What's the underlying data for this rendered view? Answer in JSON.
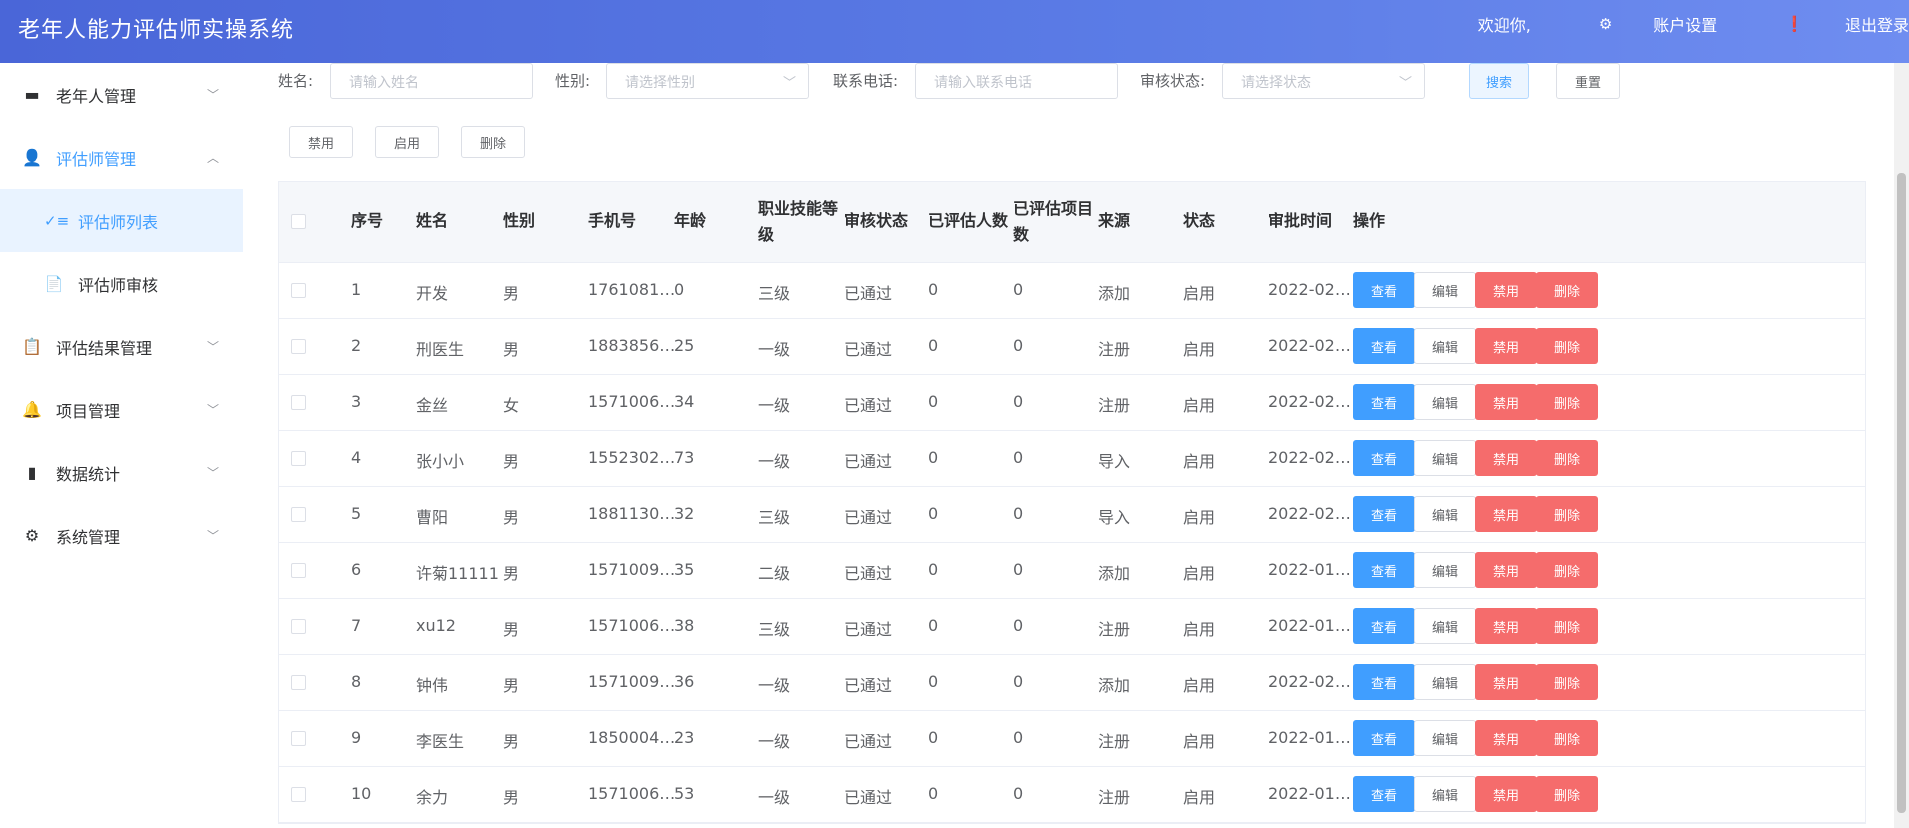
{
  "header": {
    "app_title": "老年人能力评估师实操系统",
    "welcome": "欢迎你,",
    "account_settings": "账户设置",
    "logout": "退出登录"
  },
  "sidebar": {
    "items": [
      {
        "label": "老年人管理",
        "icon": "monitor-icon"
      },
      {
        "label": "评估师管理",
        "icon": "user-icon"
      },
      {
        "label": "评估结果管理",
        "icon": "clipboard-icon"
      },
      {
        "label": "项目管理",
        "icon": "bell-icon"
      },
      {
        "label": "数据统计",
        "icon": "bar-chart-icon"
      },
      {
        "label": "系统管理",
        "icon": "gear-icon"
      }
    ],
    "subitems": [
      {
        "label": "评估师列表",
        "icon": "list-check-icon"
      },
      {
        "label": "评估师审核",
        "icon": "document-icon"
      }
    ]
  },
  "filters": {
    "name_label": "姓名:",
    "name_placeholder": "请输入姓名",
    "gender_label": "性别:",
    "gender_placeholder": "请选择性别",
    "phone_label": "联系电话:",
    "phone_placeholder": "请输入联系电话",
    "status_label": "审核状态:",
    "status_placeholder": "请选择状态",
    "search_button": "搜索",
    "reset_button": "重置"
  },
  "bulk_actions": {
    "disable": "禁用",
    "enable": "启用",
    "delete": "删除"
  },
  "table": {
    "headers": {
      "index": "序号",
      "name": "姓名",
      "gender": "性别",
      "phone": "手机号",
      "age": "年龄",
      "level_line1": "职业技能等",
      "level_line2": "级",
      "audit_status": "审核状态",
      "assessed_people": "已评估人数",
      "assessed_items_line1": "已评估项目",
      "assessed_items_line2": "数",
      "source": "来源",
      "status": "状态",
      "approval_time": "审批时间",
      "actions": "操作"
    },
    "row_actions": {
      "view": "查看",
      "edit": "编辑",
      "disable": "禁用",
      "delete": "删除"
    },
    "rows": [
      {
        "index": "1",
        "name": "开发",
        "gender": "男",
        "phone": "1761081…",
        "age": "0",
        "level": "三级",
        "audit_status": "已通过",
        "assessed_people": "0",
        "assessed_items": "0",
        "source": "添加",
        "status": "启用",
        "approval_time": "2022-02…"
      },
      {
        "index": "2",
        "name": "刑医生",
        "gender": "男",
        "phone": "1883856…",
        "age": "25",
        "level": "一级",
        "audit_status": "已通过",
        "assessed_people": "0",
        "assessed_items": "0",
        "source": "注册",
        "status": "启用",
        "approval_time": "2022-02…"
      },
      {
        "index": "3",
        "name": "金丝",
        "gender": "女",
        "phone": "1571006…",
        "age": "34",
        "level": "一级",
        "audit_status": "已通过",
        "assessed_people": "0",
        "assessed_items": "0",
        "source": "注册",
        "status": "启用",
        "approval_time": "2022-02…"
      },
      {
        "index": "4",
        "name": "张小小",
        "gender": "男",
        "phone": "1552302…",
        "age": "73",
        "level": "一级",
        "audit_status": "已通过",
        "assessed_people": "0",
        "assessed_items": "0",
        "source": "导入",
        "status": "启用",
        "approval_time": "2022-02…"
      },
      {
        "index": "5",
        "name": "曹阳",
        "gender": "男",
        "phone": "1881130…",
        "age": "32",
        "level": "三级",
        "audit_status": "已通过",
        "assessed_people": "0",
        "assessed_items": "0",
        "source": "导入",
        "status": "启用",
        "approval_time": "2022-02…"
      },
      {
        "index": "6",
        "name": "许菊11111",
        "gender": "男",
        "phone": "1571009…",
        "age": "35",
        "level": "二级",
        "audit_status": "已通过",
        "assessed_people": "0",
        "assessed_items": "0",
        "source": "添加",
        "status": "启用",
        "approval_time": "2022-01…"
      },
      {
        "index": "7",
        "name": "xu12",
        "gender": "男",
        "phone": "1571006…",
        "age": "38",
        "level": "三级",
        "audit_status": "已通过",
        "assessed_people": "0",
        "assessed_items": "0",
        "source": "注册",
        "status": "启用",
        "approval_time": "2022-01…"
      },
      {
        "index": "8",
        "name": "钟伟",
        "gender": "男",
        "phone": "1571009…",
        "age": "36",
        "level": "一级",
        "audit_status": "已通过",
        "assessed_people": "0",
        "assessed_items": "0",
        "source": "添加",
        "status": "启用",
        "approval_time": "2022-02…"
      },
      {
        "index": "9",
        "name": "李医生",
        "gender": "男",
        "phone": "1850004…",
        "age": "23",
        "level": "一级",
        "audit_status": "已通过",
        "assessed_people": "0",
        "assessed_items": "0",
        "source": "注册",
        "status": "启用",
        "approval_time": "2022-01…"
      },
      {
        "index": "10",
        "name": "余力",
        "gender": "男",
        "phone": "1571006…",
        "age": "53",
        "level": "一级",
        "audit_status": "已通过",
        "assessed_people": "0",
        "assessed_items": "0",
        "source": "注册",
        "status": "启用",
        "approval_time": "2022-01…"
      }
    ]
  },
  "colors": {
    "header_bg": "#4a66d8",
    "primary": "#409eff",
    "danger": "#f56c6c"
  }
}
